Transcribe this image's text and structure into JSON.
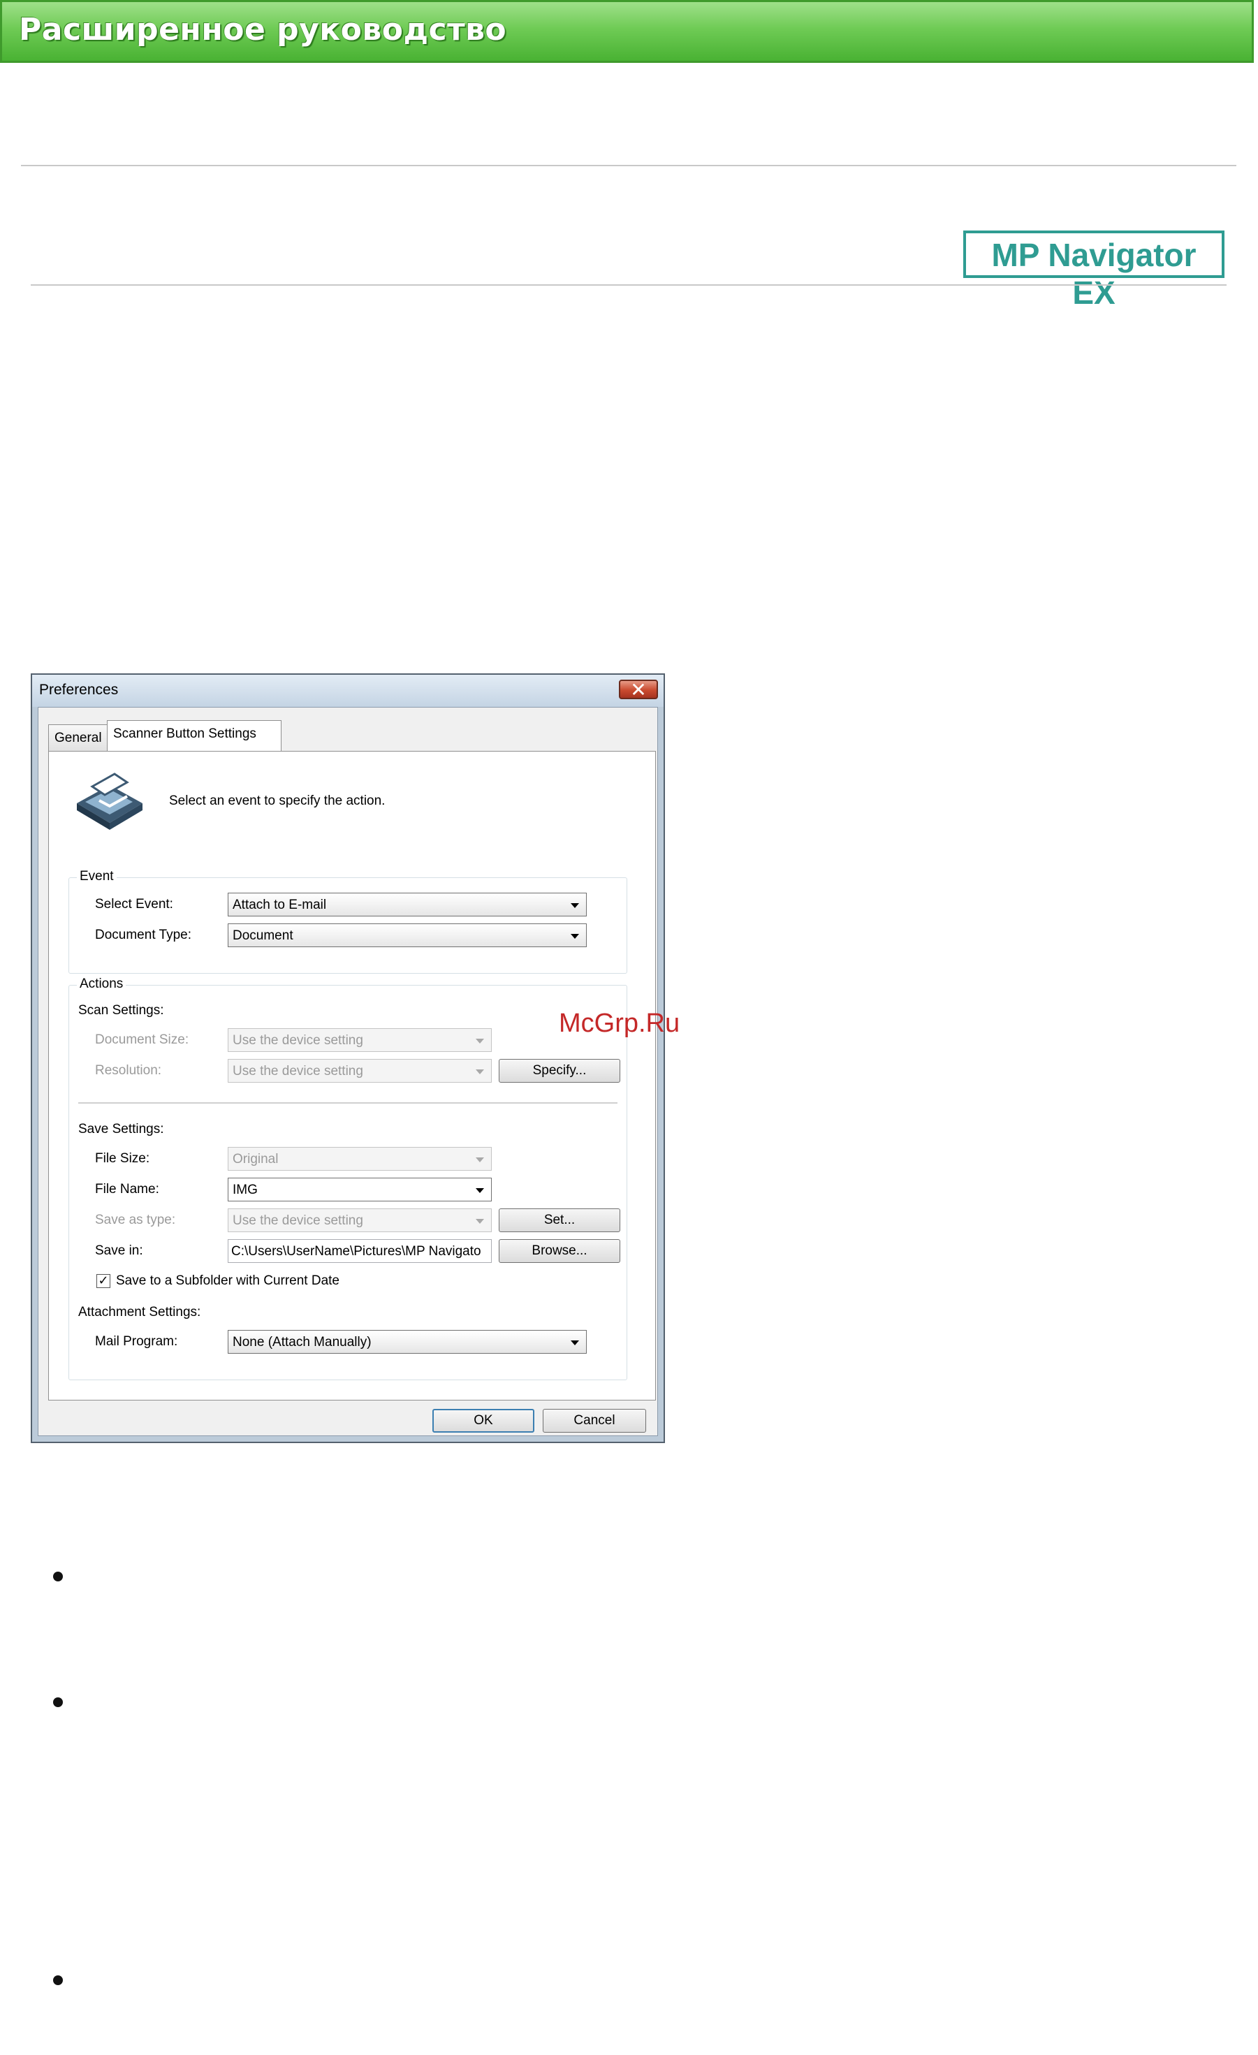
{
  "header": {
    "title": "Расширенное руководство"
  },
  "badge": {
    "label": "MP Navigator EX"
  },
  "watermark": "McGrp.Ru",
  "dialog": {
    "title": "Preferences",
    "close_glyph": "✕",
    "tabs": [
      {
        "label": "General",
        "active": false
      },
      {
        "label": "Scanner Button Settings",
        "active": true
      }
    ],
    "instruction": "Select an event to specify the action.",
    "event_group": {
      "title": "Event",
      "select_event_label": "Select Event:",
      "select_event_value": "Attach to E-mail",
      "document_type_label": "Document Type:",
      "document_type_value": "Document"
    },
    "actions_group": {
      "title": "Actions",
      "scan_settings_label": "Scan Settings:",
      "document_size_label": "Document Size:",
      "document_size_value": "Use the device setting",
      "resolution_label": "Resolution:",
      "resolution_value": "Use the device setting",
      "specify_button": "Specify...",
      "save_settings_label": "Save Settings:",
      "file_size_label": "File Size:",
      "file_size_value": "Original",
      "file_name_label": "File Name:",
      "file_name_value": "IMG",
      "save_as_type_label": "Save as type:",
      "save_as_type_value": "Use the device setting",
      "set_button": "Set...",
      "save_in_label": "Save in:",
      "save_in_value": "C:\\Users\\UserName\\Pictures\\MP Navigato",
      "browse_button": "Browse...",
      "subfolder_checkbox_label": "Save to a Subfolder with Current Date",
      "subfolder_checked": true,
      "check_glyph": "✓",
      "attachment_settings_label": "Attachment Settings:",
      "mail_program_label": "Mail Program:",
      "mail_program_value": "None (Attach Manually)"
    },
    "ok_button": "OK",
    "cancel_button": "Cancel"
  },
  "colors": {
    "banner_green": "#6fcb55",
    "badge_teal": "#2f9c92",
    "watermark_red": "#c42828"
  }
}
